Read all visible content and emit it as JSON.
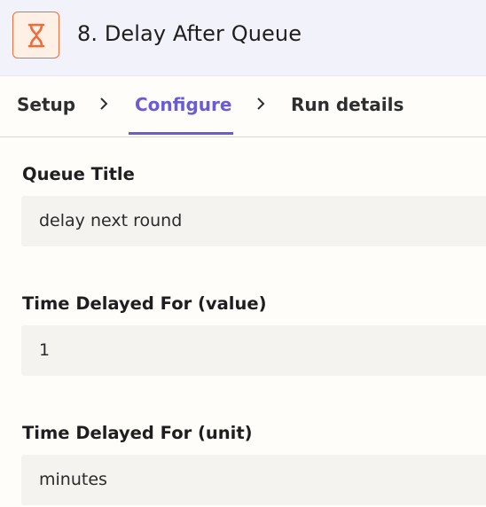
{
  "header": {
    "title": "8. Delay After Queue",
    "icon": "hourglass-icon",
    "accent": "#f26b3a"
  },
  "tabs": [
    {
      "label": "Setup",
      "active": false
    },
    {
      "label": "Configure",
      "active": true
    },
    {
      "label": "Run details",
      "active": false
    }
  ],
  "colors": {
    "active_tab": "#6b5bd6"
  },
  "fields": [
    {
      "label": "Queue Title",
      "value": "delay next round"
    },
    {
      "label": "Time Delayed For (value)",
      "value": "1"
    },
    {
      "label": "Time Delayed For (unit)",
      "value": "minutes"
    }
  ]
}
